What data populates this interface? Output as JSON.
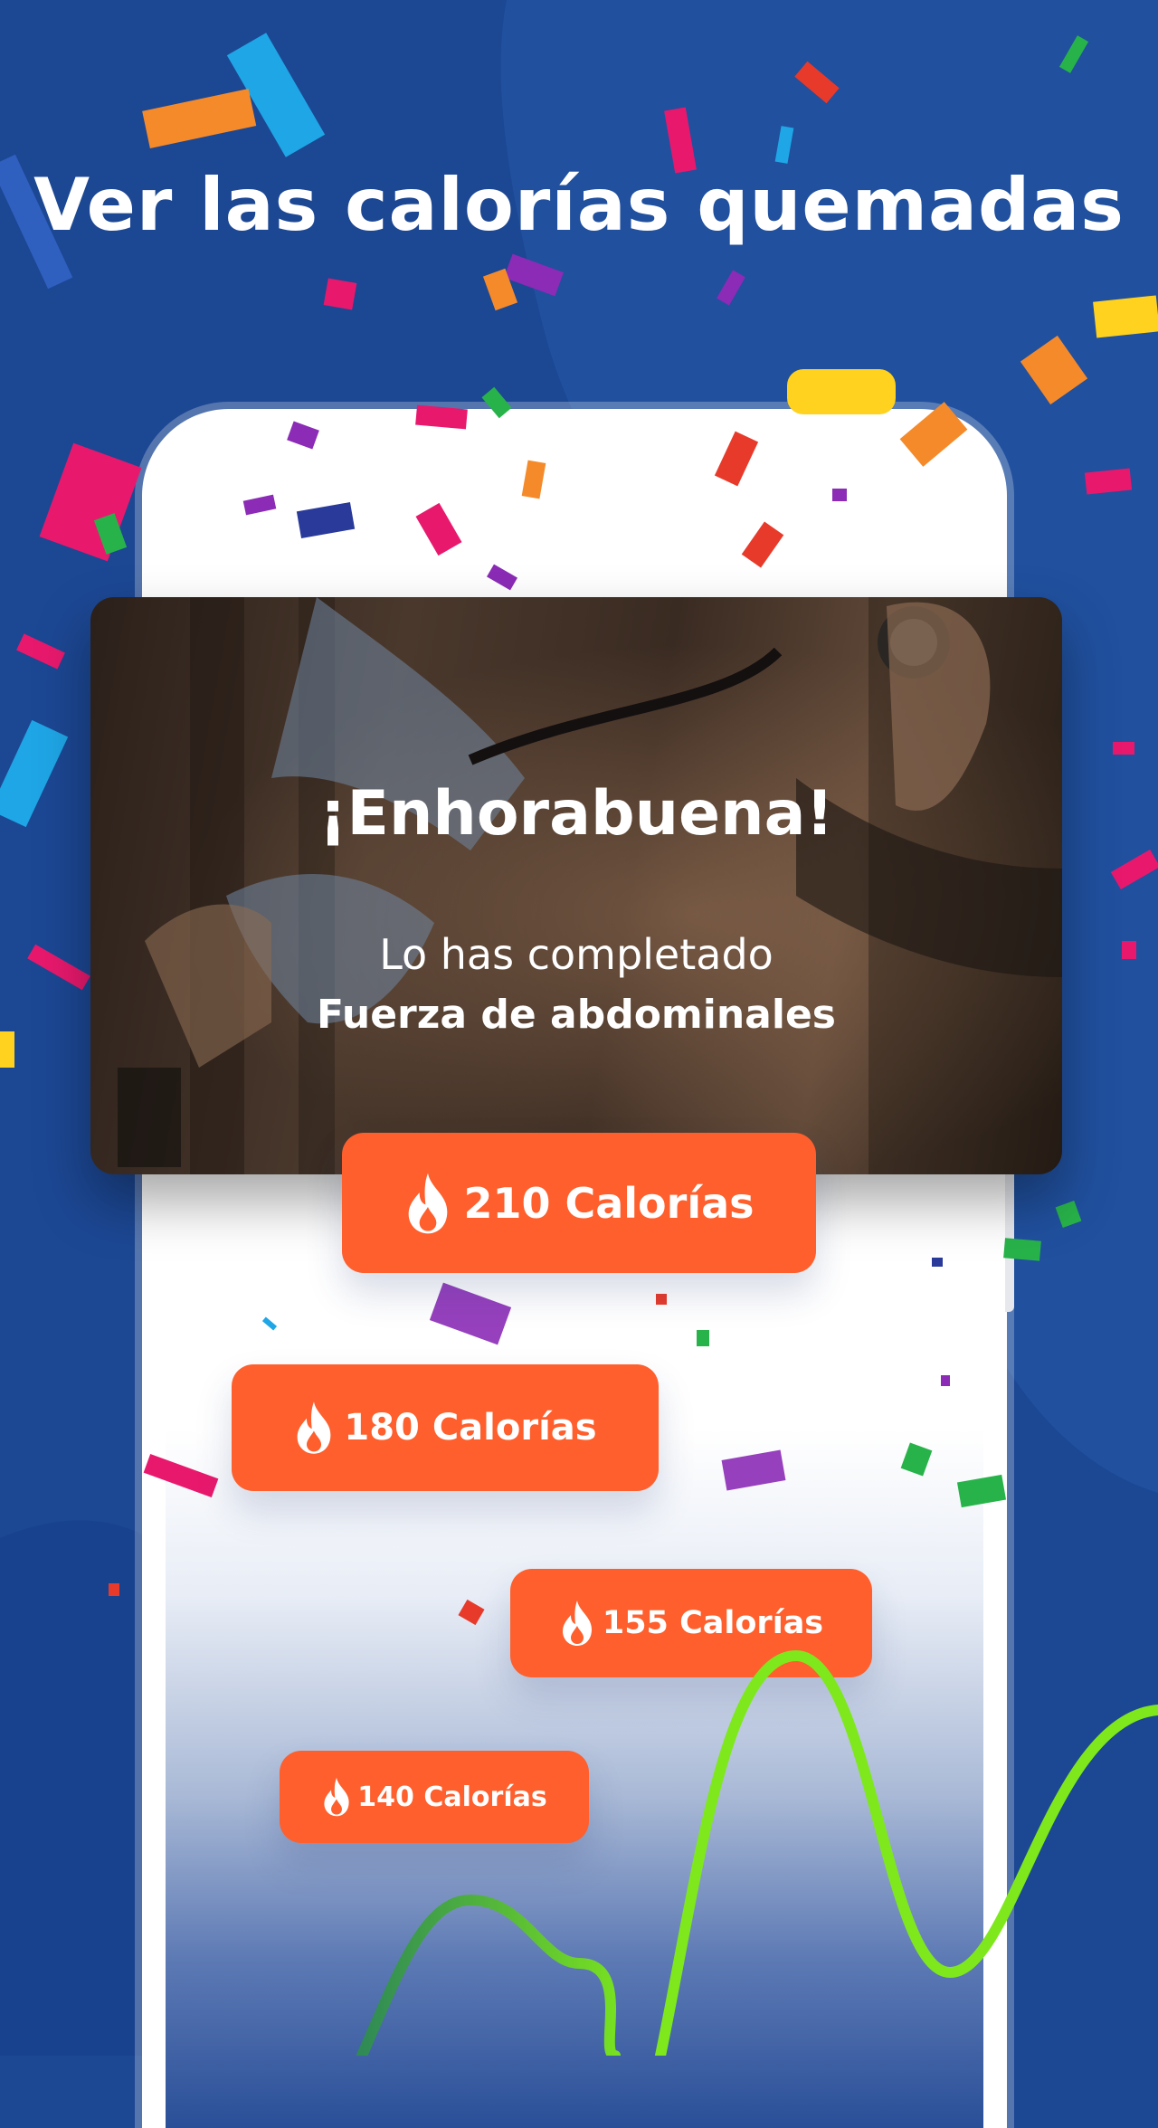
{
  "headline": "Ver las calorías quemadas",
  "card": {
    "title": "¡Enhorabuena!",
    "subtitle": "Lo has completado",
    "workout": "Fuerza de abdominales"
  },
  "calorie_badges": [
    {
      "label": "210 Calorías",
      "icon": "flame-icon"
    },
    {
      "label": "180 Calorías",
      "icon": "flame-icon"
    },
    {
      "label": "155 Calorías",
      "icon": "flame-icon"
    },
    {
      "label": "140 Calorías",
      "icon": "flame-icon"
    }
  ],
  "colors": {
    "background": "#1c4793",
    "accent": "#fe5f2c",
    "wave": "#7ee81c",
    "text": "#ffffff"
  }
}
